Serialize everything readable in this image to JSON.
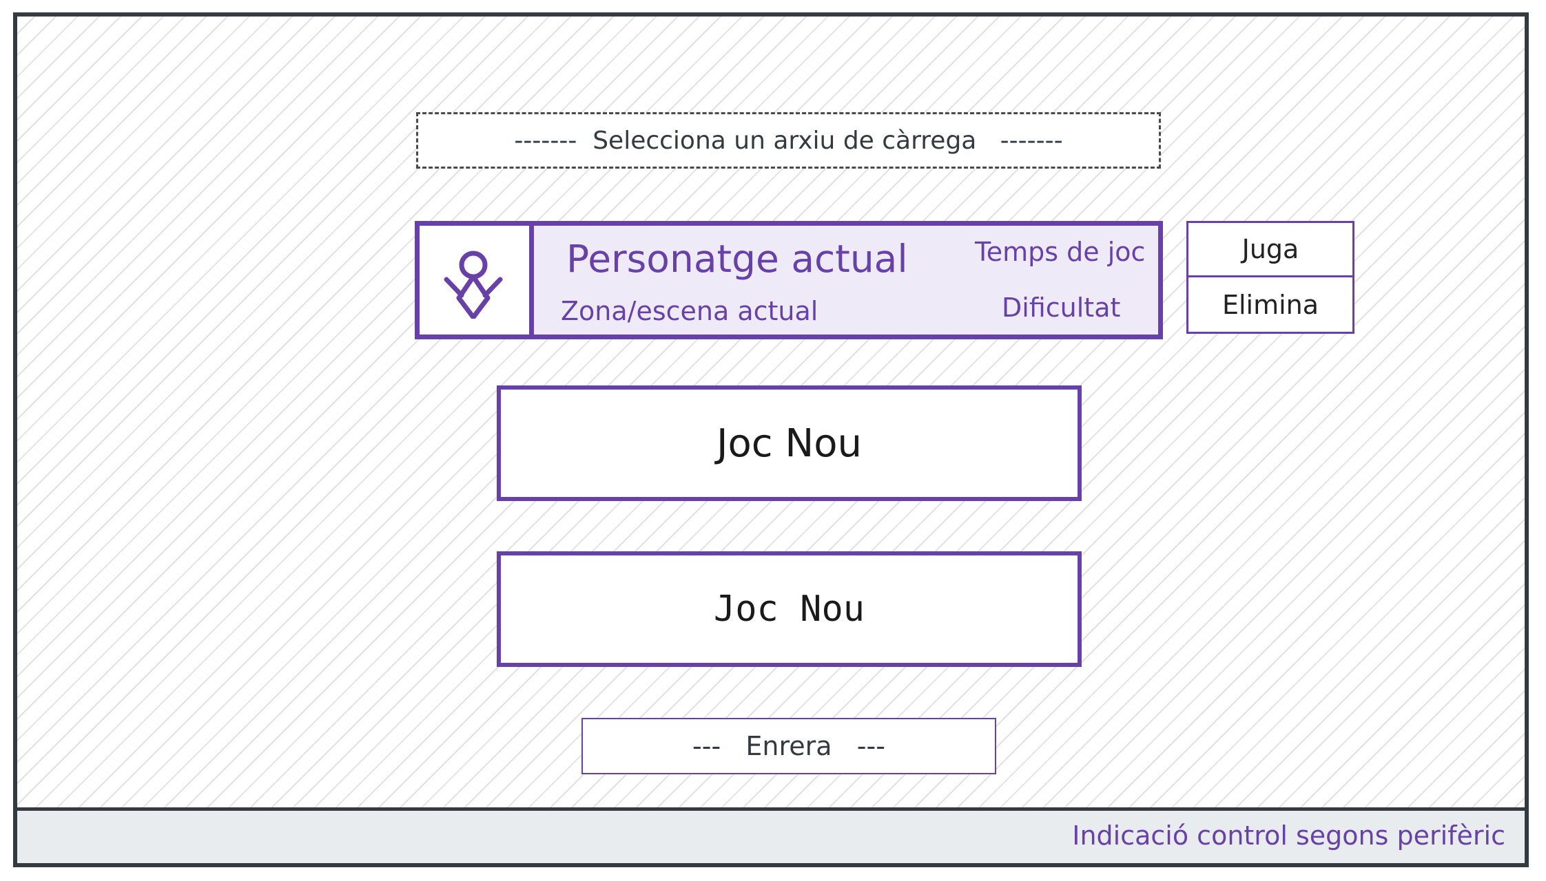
{
  "file_select": {
    "label": "-------  Selecciona un arxiu de càrrega   -------"
  },
  "save_slot": {
    "character": "Personatge actual",
    "zone": "Zona/escena actual",
    "playtime": "Temps de joc",
    "difficulty": "Dificultat",
    "avatar_icon": "person-icon"
  },
  "slot_actions": {
    "play": "Juga",
    "delete": "Elimina"
  },
  "buttons": {
    "new_game_1": "Joc Nou",
    "new_game_2": "Joc Nou"
  },
  "back_button": {
    "label": "---   Enrera   ---"
  },
  "footer": {
    "hint": "Indicació control segons perifèric"
  },
  "colors": {
    "accent": "#6741a8",
    "card_fill": "#efeaf7",
    "frame": "#343a40",
    "footer_bg": "#e9ecef"
  }
}
